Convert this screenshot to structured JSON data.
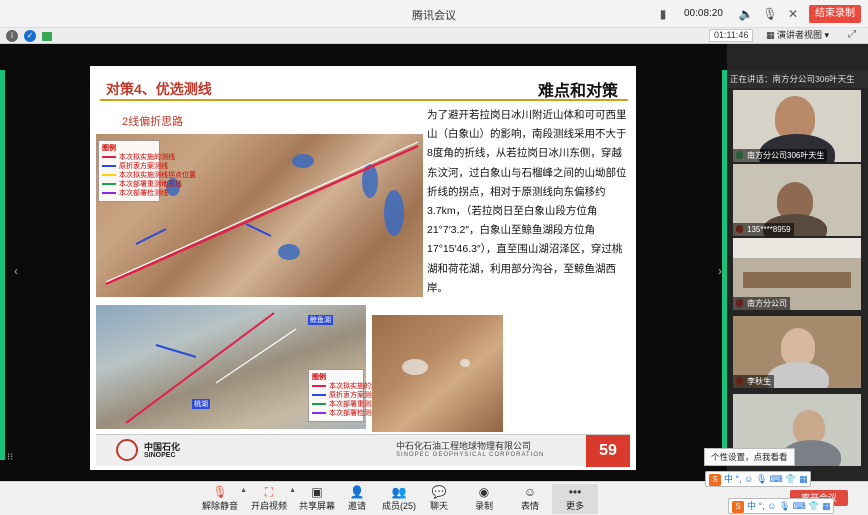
{
  "window": {
    "app_title": "腾讯会议",
    "timer": "00:08:20",
    "end_button": "结束录制"
  },
  "status": {
    "elapsed": "01:11:46",
    "view_mode": "演讲者视图"
  },
  "slide": {
    "title": "对策4、优选测线",
    "heading": "难点和对策",
    "subtitle": "2线偏折思路",
    "body": "为了避开若拉岗日冰川附近山体和可可西里山（白象山）的影响，南段测线采用不大于8度角的折线，从若拉岗日冰川东侧，穿越东汶河，过白象山与石榴峰之间的山坳部位折线的拐点，相对于原测线向东偏移约3.7km，（若拉岗日至白象山段方位角21°7′3.2″，白象山至鲸鱼湖段方位角17°15′46.3″），直至围山湖沼泽区，穿过桃湖和荷花湖，利用部分沟谷，至鲸鱼湖西岸。",
    "legend1": {
      "title": "图例",
      "items": [
        "本次拟实施的测线",
        "原折衷方案测线",
        "本次拟实施测线拐点位置",
        "本次部署重测地质线",
        "本次部署检测线"
      ]
    },
    "legend2": {
      "title": "图例",
      "items": [
        "本次拟实施的测线",
        "原折衷方案测线",
        "本次部署重测地质线",
        "本次部署检测线"
      ]
    },
    "map_labels": {
      "lake1": "鲸鱼湖",
      "lake2": "桃湖"
    },
    "footer": {
      "logo_cn": "中国石化",
      "logo_en": "SINOPEC",
      "corp_cn": "中石化石油工程地球物理有限公司",
      "corp_en": "SINOPEC GEOPHYSICAL CORPORATION",
      "page": "59"
    }
  },
  "panel": {
    "speaking": "正在讲话：南方分公司306叶天生",
    "participants": [
      {
        "name": "南方分公司306叶天生",
        "mic": "on"
      },
      {
        "name": "135****8959",
        "mic": "muted"
      },
      {
        "name": "南方分公司",
        "mic": "muted"
      },
      {
        "name": "李秋生",
        "mic": "muted"
      },
      {
        "name": "",
        "mic": "muted"
      }
    ]
  },
  "toolbar": {
    "unmute": "解除静音",
    "video": "开启视频",
    "share": "共享屏幕",
    "invite": "邀请",
    "members": "成员(25)",
    "chat": "聊天",
    "record": "录制",
    "reactions": "表情",
    "more": "更多",
    "leave": "离开会议"
  },
  "ime": {
    "tooltip": "个性设置，点我看看",
    "mode": "中",
    "punct": "°,"
  },
  "colors": {
    "accent_red": "#e84a3c",
    "active_green": "#19c07a"
  }
}
